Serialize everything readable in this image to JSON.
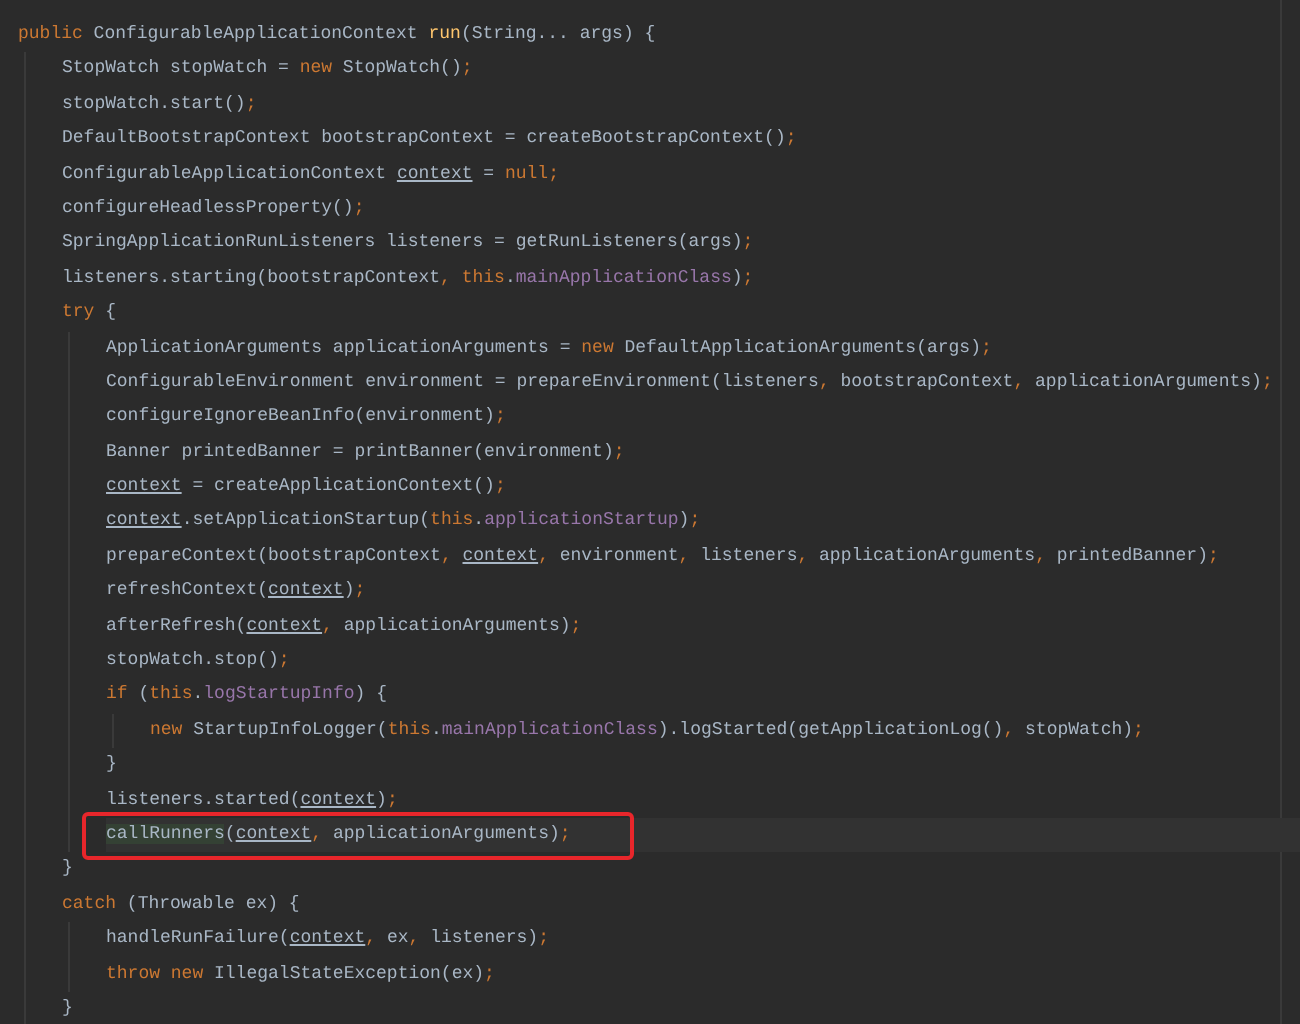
{
  "editor": {
    "lines": [
      {
        "highlighted": false,
        "tokens": [
          {
            "kind": "k",
            "text": "public"
          },
          {
            "kind": "t",
            "text": " ConfigurableApplicationContext "
          },
          {
            "kind": "m",
            "text": "run"
          },
          {
            "kind": "t",
            "text": "(String... args) {"
          }
        ],
        "children": [
          {
            "highlighted": false,
            "tokens": [
              {
                "kind": "t",
                "text": "StopWatch stopWatch = "
              },
              {
                "kind": "k",
                "text": "new"
              },
              {
                "kind": "t",
                "text": " StopWatch()"
              },
              {
                "kind": "p",
                "text": ";"
              }
            ]
          },
          {
            "highlighted": false,
            "tokens": [
              {
                "kind": "t",
                "text": "stopWatch.start()"
              },
              {
                "kind": "p",
                "text": ";"
              }
            ]
          },
          {
            "highlighted": false,
            "tokens": [
              {
                "kind": "t",
                "text": "DefaultBootstrapContext bootstrapContext = createBootstrapContext()"
              },
              {
                "kind": "p",
                "text": ";"
              }
            ]
          },
          {
            "highlighted": false,
            "tokens": [
              {
                "kind": "t",
                "text": "ConfigurableApplicationContext "
              },
              {
                "kind": "v",
                "text": "context"
              },
              {
                "kind": "t",
                "text": " = "
              },
              {
                "kind": "k",
                "text": "null"
              },
              {
                "kind": "p",
                "text": ";"
              }
            ]
          },
          {
            "highlighted": false,
            "tokens": [
              {
                "kind": "t",
                "text": "configureHeadlessProperty()"
              },
              {
                "kind": "p",
                "text": ";"
              }
            ]
          },
          {
            "highlighted": false,
            "tokens": [
              {
                "kind": "t",
                "text": "SpringApplicationRunListeners listeners = getRunListeners(args)"
              },
              {
                "kind": "p",
                "text": ";"
              }
            ]
          },
          {
            "highlighted": false,
            "tokens": [
              {
                "kind": "t",
                "text": "listeners.starting(bootstrapContext"
              },
              {
                "kind": "p",
                "text": ", "
              },
              {
                "kind": "k",
                "text": "this"
              },
              {
                "kind": "t",
                "text": "."
              },
              {
                "kind": "f",
                "text": "mainApplicationClass"
              },
              {
                "kind": "t",
                "text": ")"
              },
              {
                "kind": "p",
                "text": ";"
              }
            ]
          },
          {
            "highlighted": false,
            "tokens": [
              {
                "kind": "k",
                "text": "try"
              },
              {
                "kind": "t",
                "text": " {"
              }
            ],
            "children": [
              {
                "highlighted": false,
                "tokens": [
                  {
                    "kind": "t",
                    "text": "ApplicationArguments applicationArguments = "
                  },
                  {
                    "kind": "k",
                    "text": "new"
                  },
                  {
                    "kind": "t",
                    "text": " DefaultApplicationArguments(args)"
                  },
                  {
                    "kind": "p",
                    "text": ";"
                  }
                ]
              },
              {
                "highlighted": false,
                "tokens": [
                  {
                    "kind": "t",
                    "text": "ConfigurableEnvironment environment = prepareEnvironment(listeners"
                  },
                  {
                    "kind": "p",
                    "text": ", "
                  },
                  {
                    "kind": "t",
                    "text": "bootstrapContext"
                  },
                  {
                    "kind": "p",
                    "text": ", "
                  },
                  {
                    "kind": "t",
                    "text": "applicationArguments)"
                  },
                  {
                    "kind": "p",
                    "text": ";"
                  }
                ]
              },
              {
                "highlighted": false,
                "tokens": [
                  {
                    "kind": "t",
                    "text": "configureIgnoreBeanInfo(environment)"
                  },
                  {
                    "kind": "p",
                    "text": ";"
                  }
                ]
              },
              {
                "highlighted": false,
                "tokens": [
                  {
                    "kind": "t",
                    "text": "Banner printedBanner = printBanner(environment)"
                  },
                  {
                    "kind": "p",
                    "text": ";"
                  }
                ]
              },
              {
                "highlighted": false,
                "tokens": [
                  {
                    "kind": "v",
                    "text": "context"
                  },
                  {
                    "kind": "t",
                    "text": " = createApplicationContext()"
                  },
                  {
                    "kind": "p",
                    "text": ";"
                  }
                ]
              },
              {
                "highlighted": false,
                "tokens": [
                  {
                    "kind": "v",
                    "text": "context"
                  },
                  {
                    "kind": "t",
                    "text": ".setApplicationStartup("
                  },
                  {
                    "kind": "k",
                    "text": "this"
                  },
                  {
                    "kind": "t",
                    "text": "."
                  },
                  {
                    "kind": "f",
                    "text": "applicationStartup"
                  },
                  {
                    "kind": "t",
                    "text": ")"
                  },
                  {
                    "kind": "p",
                    "text": ";"
                  }
                ]
              },
              {
                "highlighted": false,
                "tokens": [
                  {
                    "kind": "t",
                    "text": "prepareContext(bootstrapContext"
                  },
                  {
                    "kind": "p",
                    "text": ", "
                  },
                  {
                    "kind": "v",
                    "text": "context"
                  },
                  {
                    "kind": "p",
                    "text": ", "
                  },
                  {
                    "kind": "t",
                    "text": "environment"
                  },
                  {
                    "kind": "p",
                    "text": ", "
                  },
                  {
                    "kind": "t",
                    "text": "listeners"
                  },
                  {
                    "kind": "p",
                    "text": ", "
                  },
                  {
                    "kind": "t",
                    "text": "applicationArguments"
                  },
                  {
                    "kind": "p",
                    "text": ", "
                  },
                  {
                    "kind": "t",
                    "text": "printedBanner)"
                  },
                  {
                    "kind": "p",
                    "text": ";"
                  }
                ]
              },
              {
                "highlighted": false,
                "tokens": [
                  {
                    "kind": "t",
                    "text": "refreshContext("
                  },
                  {
                    "kind": "v",
                    "text": "context"
                  },
                  {
                    "kind": "t",
                    "text": ")"
                  },
                  {
                    "kind": "p",
                    "text": ";"
                  }
                ]
              },
              {
                "highlighted": false,
                "tokens": [
                  {
                    "kind": "t",
                    "text": "afterRefresh("
                  },
                  {
                    "kind": "v",
                    "text": "context"
                  },
                  {
                    "kind": "p",
                    "text": ", "
                  },
                  {
                    "kind": "t",
                    "text": "applicationArguments)"
                  },
                  {
                    "kind": "p",
                    "text": ";"
                  }
                ]
              },
              {
                "highlighted": false,
                "tokens": [
                  {
                    "kind": "t",
                    "text": "stopWatch.stop()"
                  },
                  {
                    "kind": "p",
                    "text": ";"
                  }
                ]
              },
              {
                "highlighted": false,
                "tokens": [
                  {
                    "kind": "k",
                    "text": "if"
                  },
                  {
                    "kind": "t",
                    "text": " ("
                  },
                  {
                    "kind": "k",
                    "text": "this"
                  },
                  {
                    "kind": "t",
                    "text": "."
                  },
                  {
                    "kind": "f",
                    "text": "logStartupInfo"
                  },
                  {
                    "kind": "t",
                    "text": ") {"
                  }
                ],
                "children": [
                  {
                    "highlighted": false,
                    "tokens": [
                      {
                        "kind": "k",
                        "text": "new"
                      },
                      {
                        "kind": "t",
                        "text": " StartupInfoLogger("
                      },
                      {
                        "kind": "k",
                        "text": "this"
                      },
                      {
                        "kind": "t",
                        "text": "."
                      },
                      {
                        "kind": "f",
                        "text": "mainApplicationClass"
                      },
                      {
                        "kind": "t",
                        "text": ").logStarted(getApplicationLog()"
                      },
                      {
                        "kind": "p",
                        "text": ", "
                      },
                      {
                        "kind": "t",
                        "text": "stopWatch)"
                      },
                      {
                        "kind": "p",
                        "text": ";"
                      }
                    ]
                  }
                ]
              },
              {
                "highlighted": false,
                "tokens": [
                  {
                    "kind": "t",
                    "text": "}"
                  }
                ]
              },
              {
                "highlighted": false,
                "tokens": [
                  {
                    "kind": "t",
                    "text": "listeners.started("
                  },
                  {
                    "kind": "v",
                    "text": "context"
                  },
                  {
                    "kind": "t",
                    "text": ")"
                  },
                  {
                    "kind": "p",
                    "text": ";"
                  }
                ]
              },
              {
                "highlighted": true,
                "tokens": [
                  {
                    "kind": "u",
                    "text": "callRunners"
                  },
                  {
                    "kind": "t",
                    "text": "("
                  },
                  {
                    "kind": "v",
                    "text": "context"
                  },
                  {
                    "kind": "p",
                    "text": ", "
                  },
                  {
                    "kind": "t",
                    "text": "applicationArguments)"
                  },
                  {
                    "kind": "p",
                    "text": ";"
                  }
                ]
              }
            ]
          },
          {
            "highlighted": false,
            "tokens": [
              {
                "kind": "t",
                "text": "}"
              }
            ]
          },
          {
            "highlighted": false,
            "tokens": [
              {
                "kind": "k",
                "text": "catch"
              },
              {
                "kind": "t",
                "text": " (Throwable ex) {"
              }
            ],
            "children": [
              {
                "highlighted": false,
                "tokens": [
                  {
                    "kind": "t",
                    "text": "handleRunFailure("
                  },
                  {
                    "kind": "v",
                    "text": "context"
                  },
                  {
                    "kind": "p",
                    "text": ", "
                  },
                  {
                    "kind": "t",
                    "text": "ex"
                  },
                  {
                    "kind": "p",
                    "text": ", "
                  },
                  {
                    "kind": "t",
                    "text": "listeners)"
                  },
                  {
                    "kind": "p",
                    "text": ";"
                  }
                ]
              },
              {
                "highlighted": false,
                "tokens": [
                  {
                    "kind": "k",
                    "text": "throw new"
                  },
                  {
                    "kind": "t",
                    "text": " IllegalStateException(ex)"
                  },
                  {
                    "kind": "p",
                    "text": ";"
                  }
                ]
              }
            ]
          },
          {
            "highlighted": false,
            "tokens": [
              {
                "kind": "t",
                "text": "}"
              }
            ]
          }
        ]
      }
    ]
  }
}
